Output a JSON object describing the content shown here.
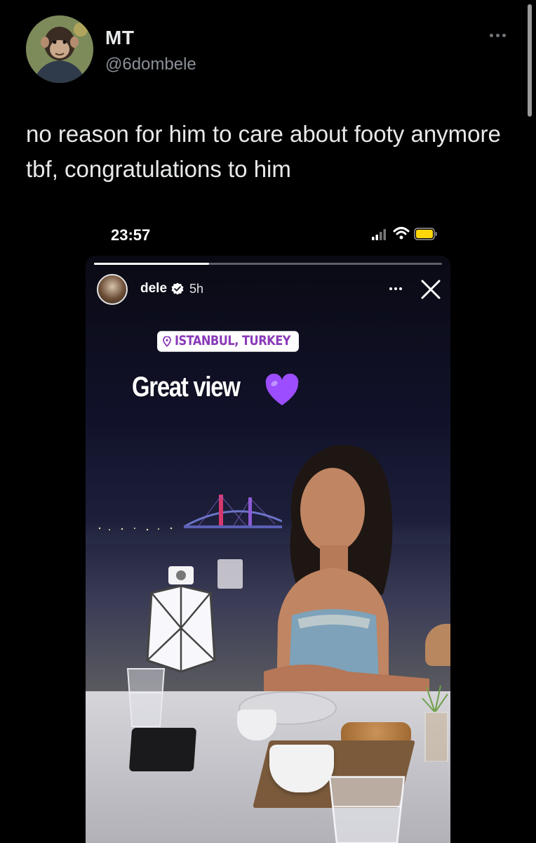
{
  "tweet": {
    "display_name": "MT",
    "handle": "@6dombele",
    "text": "no reason for him to care about footy anymore tbf, congratulations to him",
    "avatar_icon": "avatar"
  },
  "phone_status": {
    "time": "23:57"
  },
  "story": {
    "username": "dele",
    "time_ago": "5h",
    "progress_fraction": 0.33,
    "location": "ISTANBUL, TURKEY",
    "caption": "Great view",
    "caption_emoji": "purple-heart-icon"
  },
  "colors": {
    "background": "#000000",
    "text_primary": "#e7e9ea",
    "text_secondary": "#8b9098",
    "location_text": "#8a3ab9",
    "heart": "#9b4dff"
  }
}
